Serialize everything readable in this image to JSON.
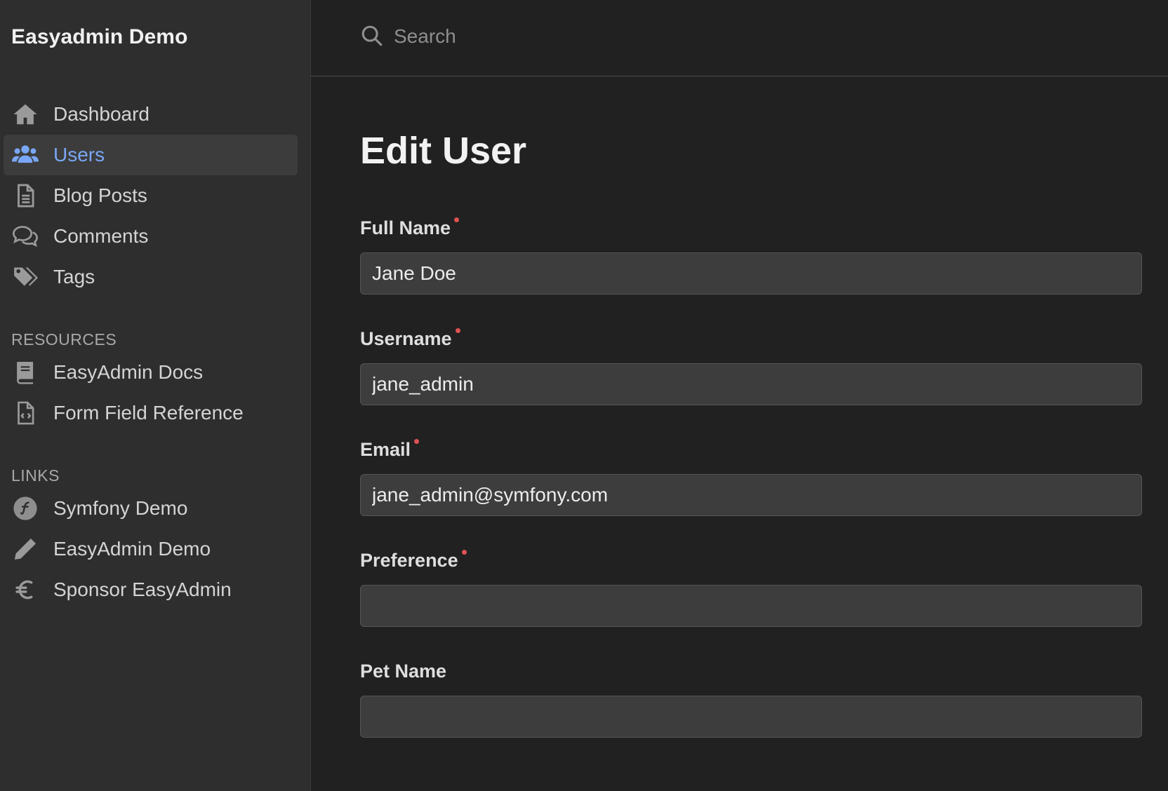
{
  "sidebar": {
    "brand": "Easyadmin Demo",
    "main_items": [
      {
        "label": "Dashboard",
        "icon": "home-icon"
      },
      {
        "label": "Users",
        "icon": "users-icon",
        "active": true
      },
      {
        "label": "Blog Posts",
        "icon": "file-icon"
      },
      {
        "label": "Comments",
        "icon": "comments-icon"
      },
      {
        "label": "Tags",
        "icon": "tags-icon"
      }
    ],
    "resources_label": "RESOURCES",
    "resources_items": [
      {
        "label": "EasyAdmin Docs",
        "icon": "book-icon"
      },
      {
        "label": "Form Field Reference",
        "icon": "file-code-icon"
      }
    ],
    "links_label": "LINKS",
    "links_items": [
      {
        "label": "Symfony Demo",
        "icon": "symfony-icon"
      },
      {
        "label": "EasyAdmin Demo",
        "icon": "pencil-icon"
      },
      {
        "label": "Sponsor EasyAdmin",
        "icon": "euro-icon"
      }
    ]
  },
  "search": {
    "placeholder": "Search"
  },
  "page": {
    "title": "Edit User"
  },
  "form": {
    "fields": [
      {
        "label": "Full Name",
        "value": "Jane Doe",
        "required": true
      },
      {
        "label": "Username",
        "value": "jane_admin",
        "required": true
      },
      {
        "label": "Email",
        "value": "jane_admin@symfony.com",
        "required": true
      },
      {
        "label": "Preference",
        "value": "",
        "required": true
      },
      {
        "label": "Pet Name",
        "value": "",
        "required": false
      }
    ]
  },
  "colors": {
    "accent": "#7aa7f5",
    "required_dot": "#e05252",
    "sidebar_bg": "#2e2e2e",
    "main_bg": "#212121"
  }
}
